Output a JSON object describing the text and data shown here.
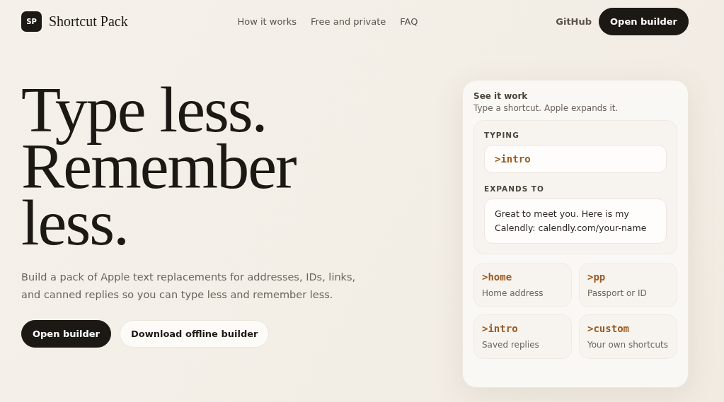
{
  "brand": {
    "logo": "SP",
    "name": "Shortcut Pack"
  },
  "nav": [
    "How it works",
    "Free and private",
    "FAQ"
  ],
  "header_actions": {
    "link": "GitHub",
    "button": "Open builder"
  },
  "hero": {
    "headline": "Type less. Remember less.",
    "description": "Build a pack of Apple text replacements for addresses, IDs, links, and canned replies so you can type less and remember less.",
    "buttons": [
      {
        "label": "Open builder",
        "kind": "primary"
      },
      {
        "label": "Download offline builder",
        "kind": "secondary"
      }
    ]
  },
  "demo": {
    "title": "See it work",
    "subtitle": "Type a shortcut. Apple expands it.",
    "typing_label": "TYPING",
    "typing_value": ">intro",
    "expands_label": "EXPANDS TO",
    "expands_value": "Great to meet you. Here is my Calendly: calendly.com/your-name",
    "shortcuts": [
      {
        "code": ">home",
        "label": "Home address"
      },
      {
        "code": ">pp",
        "label": "Passport or ID"
      },
      {
        "code": ">intro",
        "label": "Saved replies"
      },
      {
        "code": ">custom",
        "label": "Your own shortcuts"
      }
    ]
  }
}
